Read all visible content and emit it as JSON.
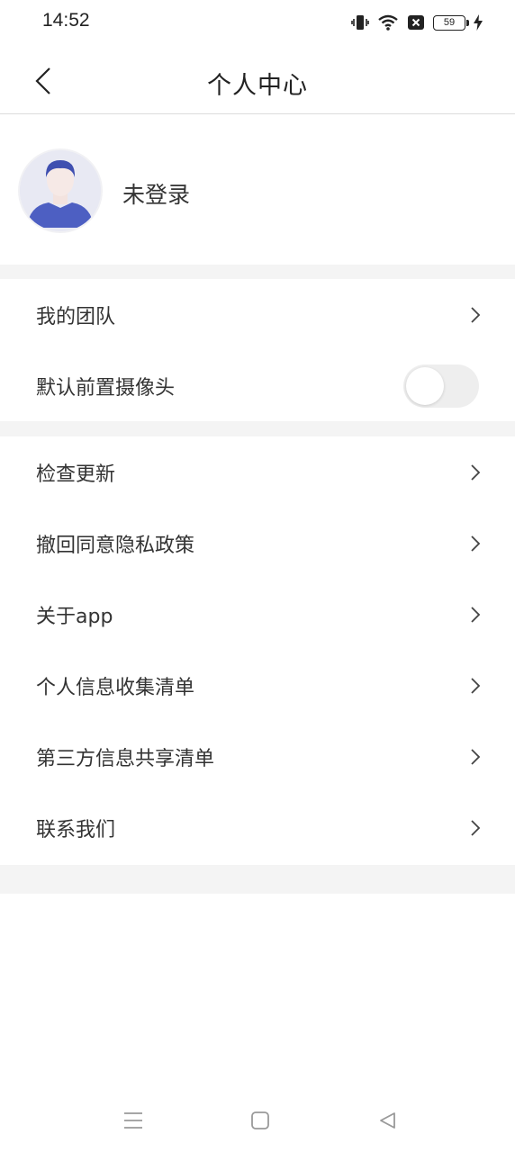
{
  "status_bar": {
    "time": "14:52",
    "battery_level": "59",
    "icons": [
      "vibrate-icon",
      "wifi-icon",
      "sim-x-icon",
      "battery-icon",
      "charging-icon"
    ]
  },
  "header": {
    "title": "个人中心",
    "back_icon": "chevron-left-icon"
  },
  "profile": {
    "name": "未登录",
    "avatar_icon": "default-user-avatar"
  },
  "group1": [
    {
      "label": "我的团队",
      "type": "link"
    },
    {
      "label": "默认前置摄像头",
      "type": "toggle",
      "toggle_on": false
    }
  ],
  "group2": [
    {
      "label": "检查更新"
    },
    {
      "label": "撤回同意隐私政策"
    },
    {
      "label": "关于app"
    },
    {
      "label": "个人信息收集清单"
    },
    {
      "label": "第三方信息共享清单"
    },
    {
      "label": "联系我们"
    }
  ],
  "navbar": {
    "buttons": [
      "menu-icon",
      "home-square-icon",
      "back-triangle-icon"
    ]
  },
  "colors": {
    "background": "#ffffff",
    "separator": "#f4f4f4",
    "text": "#333333",
    "avatar_accent": "#4d5fc2",
    "toggle_off": "#eeeeee"
  }
}
